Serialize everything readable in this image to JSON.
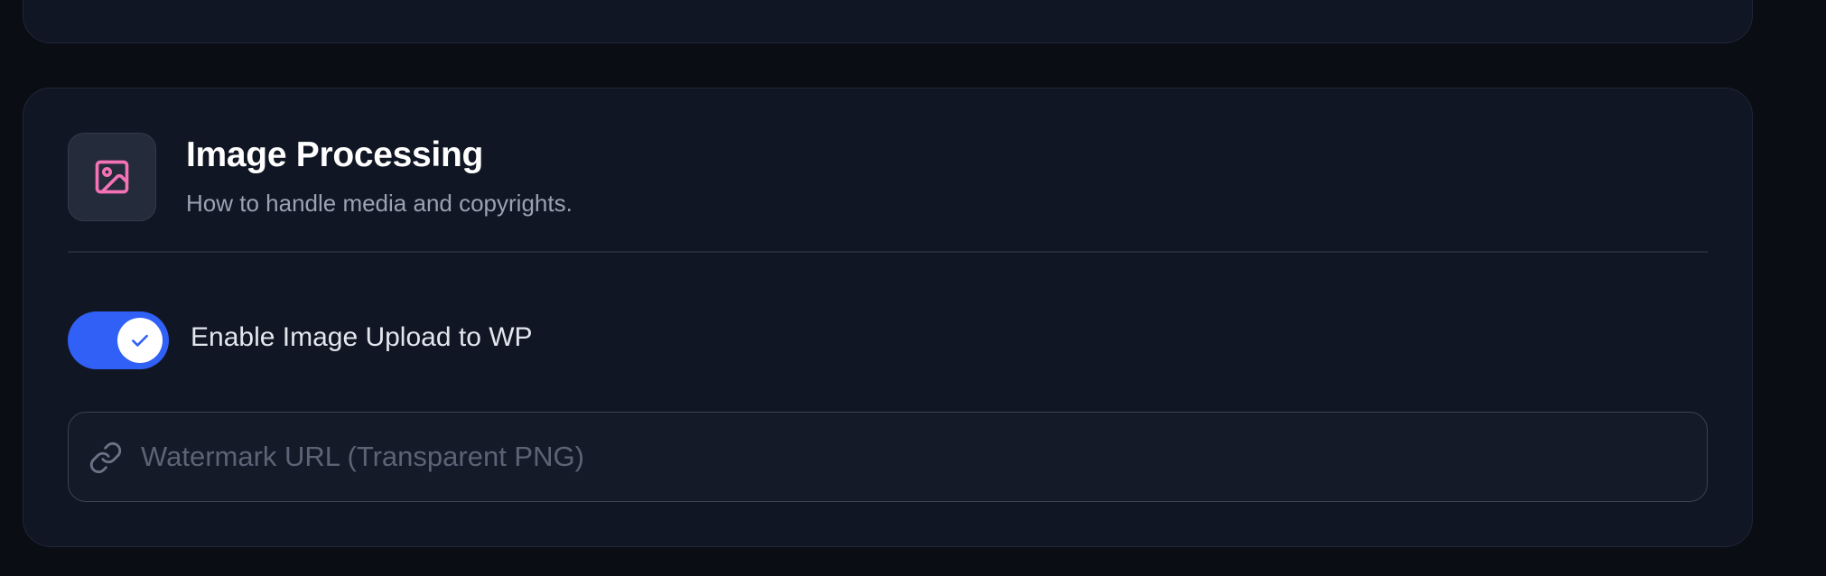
{
  "section": {
    "title": "Image Processing",
    "subtitle": "How to handle media and copyrights.",
    "icon": "image-icon",
    "icon_color": "#f472b6"
  },
  "image_upload_toggle": {
    "label": "Enable Image Upload to WP",
    "checked": true,
    "accent_color": "#3160f6"
  },
  "watermark_field": {
    "icon": "link-icon",
    "placeholder": "Watermark URL (Transparent PNG)",
    "value": ""
  }
}
